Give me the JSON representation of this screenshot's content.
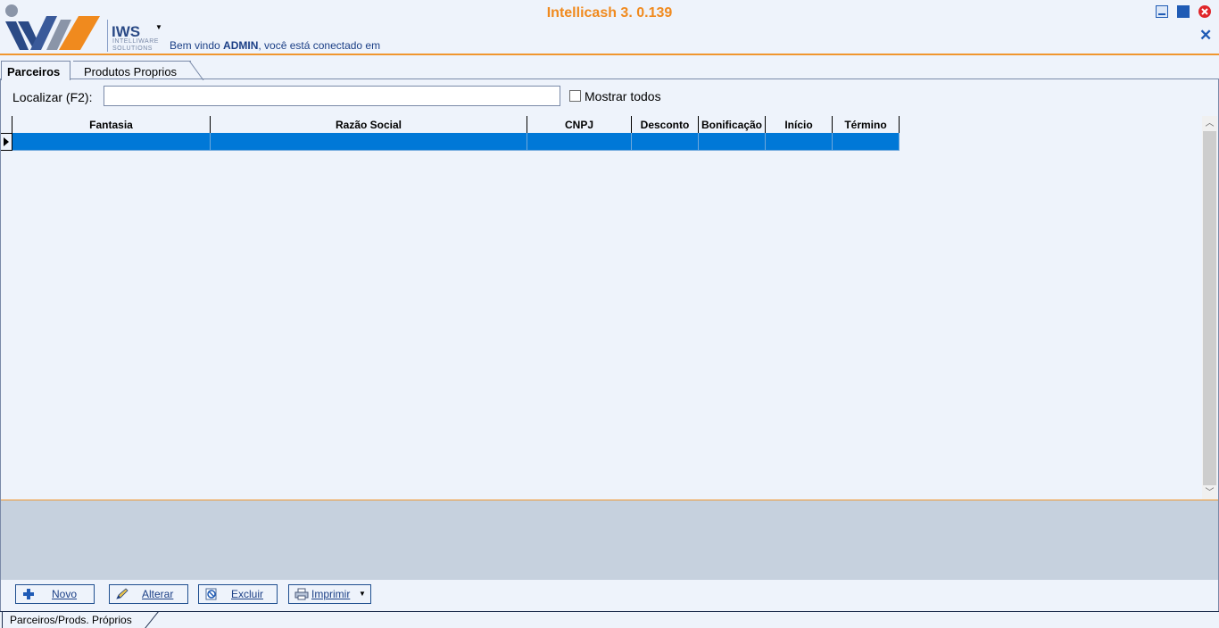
{
  "app": {
    "title": "Intellicash 3. 0.139",
    "logo_text": "IWS",
    "logo_sub1": "INTELLIWARE",
    "logo_sub2": "SOLUTIONS",
    "welcome_prefix": "Bem vindo ",
    "welcome_user": "ADMIN",
    "welcome_suffix": ", você está conectado em"
  },
  "tabs": [
    {
      "label": "Parceiros",
      "active": true
    },
    {
      "label": "Produtos Proprios",
      "active": false
    }
  ],
  "search": {
    "label": "Localizar (F2):",
    "value": "",
    "show_all_label": "Mostrar todos",
    "show_all_checked": false
  },
  "grid": {
    "columns": [
      "Fantasia",
      "Razão Social",
      "CNPJ",
      "Desconto",
      "Bonificação",
      "Início",
      "Término"
    ],
    "rows": [
      [
        "",
        "",
        "",
        "",
        "",
        "",
        ""
      ]
    ],
    "selected_row": 0
  },
  "buttons": {
    "novo": "Novo",
    "alterar": "Alterar",
    "excluir": "Excluir",
    "imprimir": "Imprimir"
  },
  "statusbar": {
    "tab_label": "Parceiros/Prods. Próprios"
  },
  "colors": {
    "accent_orange": "#f08a1e",
    "selection_blue": "#0078d7",
    "panel_bg": "#eef3fb",
    "lower_panel_bg": "#c6d1de"
  },
  "icons": [
    "plus-icon",
    "pencil-icon",
    "delete-icon",
    "printer-icon",
    "minimize-icon",
    "maximize-icon",
    "close-icon"
  ]
}
